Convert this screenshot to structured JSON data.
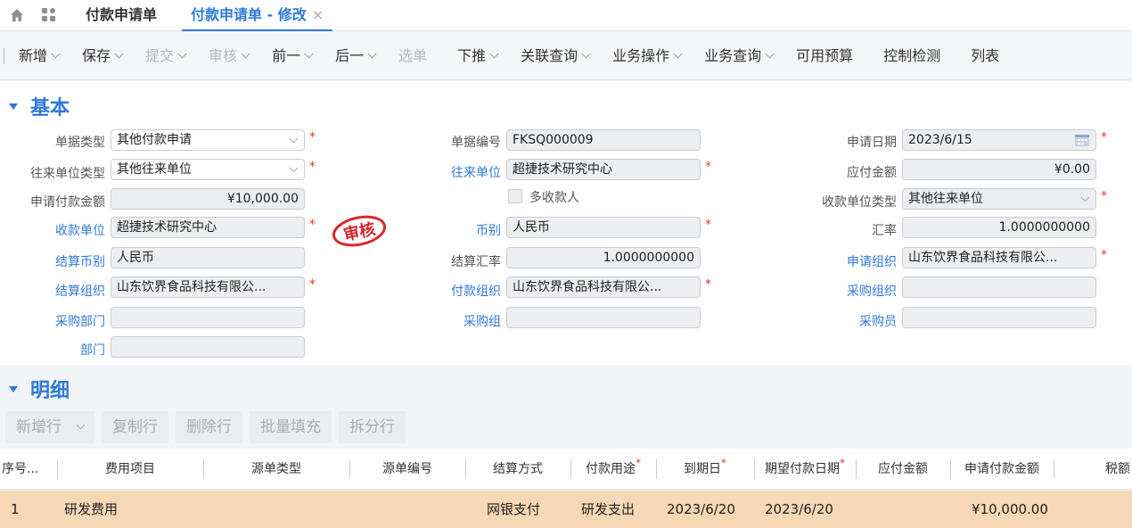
{
  "tabs": {
    "tab1": "付款申请单",
    "tab2": "付款申请单 - 修改",
    "close": "×"
  },
  "toolbar": {
    "add": "新增",
    "save": "保存",
    "submit": "提交",
    "audit": "审核",
    "prev": "前一",
    "next": "后一",
    "select": "选单",
    "push": "下推",
    "related_query": "关联查询",
    "biz_op": "业务操作",
    "biz_query": "业务查询",
    "budget": "可用预算",
    "control_check": "控制检测",
    "list": "列表"
  },
  "basic": {
    "title": "基本",
    "doc_type_label": "单据类型",
    "doc_type_value": "其他付款申请",
    "contact_type_label": "往来单位类型",
    "contact_type_value": "其他往来单位",
    "apply_amount_label": "申请付款金额",
    "apply_amount_value": "¥10,000.00",
    "payee_label": "收款单位",
    "payee_value": "超捷技术研究中心",
    "settle_currency_label": "结算币别",
    "settle_currency_value": "人民币",
    "settle_org_label": "结算组织",
    "settle_org_value": "山东饮界食品科技有限公...",
    "purchase_dept_label": "采购部门",
    "purchase_dept_value": "",
    "dept_label": "部门",
    "dept_value": "",
    "doc_no_label": "单据编号",
    "doc_no_value": "FKSQ000009",
    "contact_label": "往来单位",
    "contact_value": "超捷技术研究中心",
    "multi_payee_label": "多收款人",
    "currency_label": "币别",
    "currency_value": "人民币",
    "settle_rate_label": "结算汇率",
    "settle_rate_value": "1.0000000000",
    "pay_org_label": "付款组织",
    "pay_org_value": "山东饮界食品科技有限公...",
    "purchase_group_label": "采购组",
    "purchase_group_value": "",
    "apply_date_label": "申请日期",
    "apply_date_value": "2023/6/15",
    "payable_label": "应付金额",
    "payable_value": "¥0.00",
    "payee_type_label": "收款单位类型",
    "payee_type_value": "其他往来单位",
    "rate_label": "汇率",
    "rate_value": "1.0000000000",
    "apply_org_label": "申请组织",
    "apply_org_value": "山东饮界食品科技有限公...",
    "purchase_org_label": "采购组织",
    "purchase_org_value": "",
    "buyer_label": "采购员",
    "buyer_value": "",
    "stamp_text": "审核"
  },
  "detail": {
    "title": "明细",
    "add_row": "新增行",
    "copy_row": "复制行",
    "delete_row": "删除行",
    "batch_fill": "批量填充",
    "split_row": "拆分行",
    "columns": {
      "seq": "序号...",
      "expense": "费用项目",
      "src_type": "源单类型",
      "src_no": "源单编号",
      "settle_method": "结算方式",
      "pay_purpose": "付款用途",
      "due_date": "到期日",
      "expect_date": "期望付款日期",
      "payable": "应付金额",
      "apply_amount": "申请付款金额",
      "tax": "税额"
    },
    "row1": {
      "seq": "1",
      "expense": "研发费用",
      "settle_method": "网银支付",
      "pay_purpose": "研发支出",
      "due_date": "2023/6/20",
      "expect_date": "2023/6/20",
      "apply_amount": "¥10,000.00"
    }
  },
  "colors": {
    "accent": "#2f7ad8",
    "required": "#e53935",
    "row_highlight": "#f7d8b5",
    "stamp": "#d9252b"
  }
}
